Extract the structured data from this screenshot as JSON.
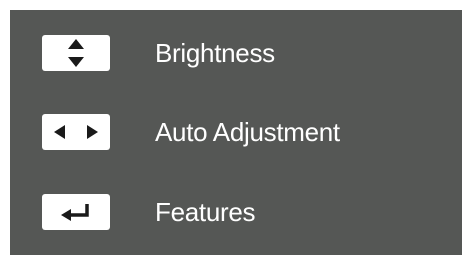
{
  "menu": {
    "items": [
      {
        "label": "Brightness",
        "icon": "up-down-arrows-icon"
      },
      {
        "label": "Auto Adjustment",
        "icon": "left-right-arrows-icon"
      },
      {
        "label": "Features",
        "icon": "enter-return-icon"
      }
    ]
  },
  "colors": {
    "panel_background": "#555755",
    "key_background": "#ffffff",
    "glyph": "#1a1a1a",
    "text": "#ffffff"
  }
}
